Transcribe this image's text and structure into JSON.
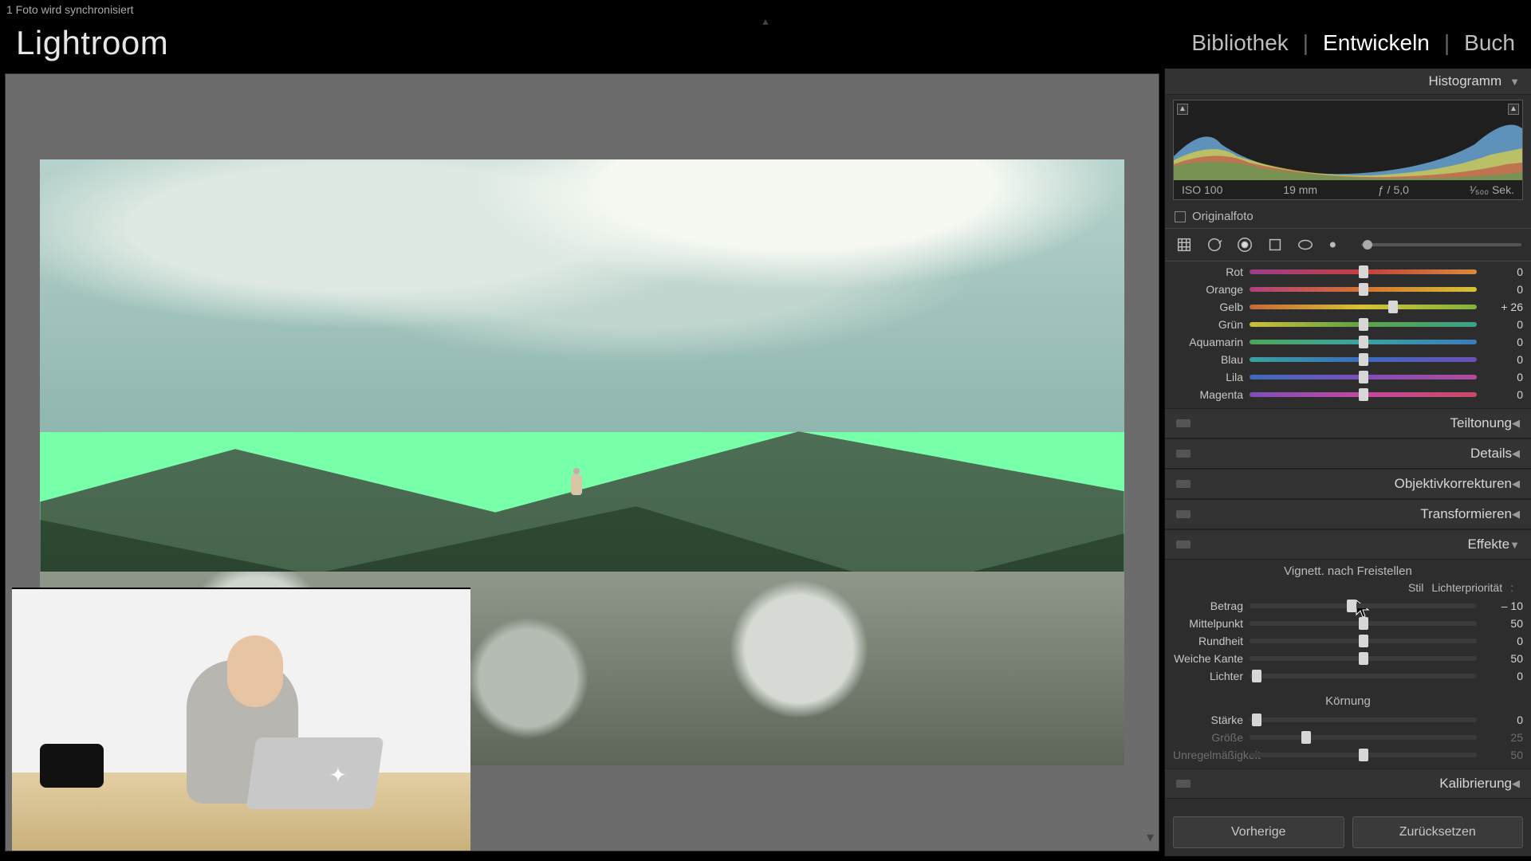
{
  "sync_status": "1 Foto wird synchronisiert",
  "app_name": "Lightroom",
  "modules": {
    "library": "Bibliothek",
    "develop": "Entwickeln",
    "book": "Buch",
    "active": "develop"
  },
  "histogram": {
    "title": "Histogramm",
    "iso": "ISO 100",
    "focal": "19 mm",
    "aperture": "ƒ / 5,0",
    "shutter": "¹⁄₅₀₀ Sek.",
    "original_label": "Originalfoto"
  },
  "hue_sliders": [
    {
      "key": "rot",
      "label": "Rot",
      "value": "0",
      "pos": 50,
      "grad": "grad-rot"
    },
    {
      "key": "orange",
      "label": "Orange",
      "value": "0",
      "pos": 50,
      "grad": "grad-org"
    },
    {
      "key": "gelb",
      "label": "Gelb",
      "value": "+ 26",
      "pos": 63,
      "grad": "grad-gelb"
    },
    {
      "key": "grun",
      "label": "Grün",
      "value": "0",
      "pos": 50,
      "grad": "grad-grun"
    },
    {
      "key": "aqua",
      "label": "Aquamarin",
      "value": "0",
      "pos": 50,
      "grad": "grad-aqua"
    },
    {
      "key": "blau",
      "label": "Blau",
      "value": "0",
      "pos": 50,
      "grad": "grad-blau"
    },
    {
      "key": "lila",
      "label": "Lila",
      "value": "0",
      "pos": 50,
      "grad": "grad-lila"
    },
    {
      "key": "mag",
      "label": "Magenta",
      "value": "0",
      "pos": 50,
      "grad": "grad-mag"
    }
  ],
  "panels": {
    "teiltonung": "Teiltonung",
    "details": "Details",
    "objektiv": "Objektivkorrekturen",
    "transform": "Transformieren",
    "effekte": "Effekte",
    "kalibrierung": "Kalibrierung"
  },
  "effekte": {
    "vignette_title": "Vignett. nach Freistellen",
    "stil_label": "Stil",
    "stil_value": "Lichterpriorität",
    "sliders": [
      {
        "key": "betrag",
        "label": "Betrag",
        "value": "– 10",
        "pos": 45,
        "dim": false
      },
      {
        "key": "mittel",
        "label": "Mittelpunkt",
        "value": "50",
        "pos": 50,
        "dim": false
      },
      {
        "key": "rund",
        "label": "Rundheit",
        "value": "0",
        "pos": 50,
        "dim": false
      },
      {
        "key": "kante",
        "label": "Weiche Kante",
        "value": "50",
        "pos": 50,
        "dim": false
      },
      {
        "key": "lichter",
        "label": "Lichter",
        "value": "0",
        "pos": 3,
        "dim": false
      }
    ],
    "grain_title": "Körnung",
    "grain": [
      {
        "key": "staerke",
        "label": "Stärke",
        "value": "0",
        "pos": 3,
        "dim": false
      },
      {
        "key": "groesse",
        "label": "Größe",
        "value": "25",
        "pos": 25,
        "dim": true
      },
      {
        "key": "unregel",
        "label": "Unregelmäßigkeit",
        "value": "50",
        "pos": 50,
        "dim": true
      }
    ]
  },
  "footer": {
    "prev": "Vorherige",
    "reset": "Zurücksetzen"
  }
}
